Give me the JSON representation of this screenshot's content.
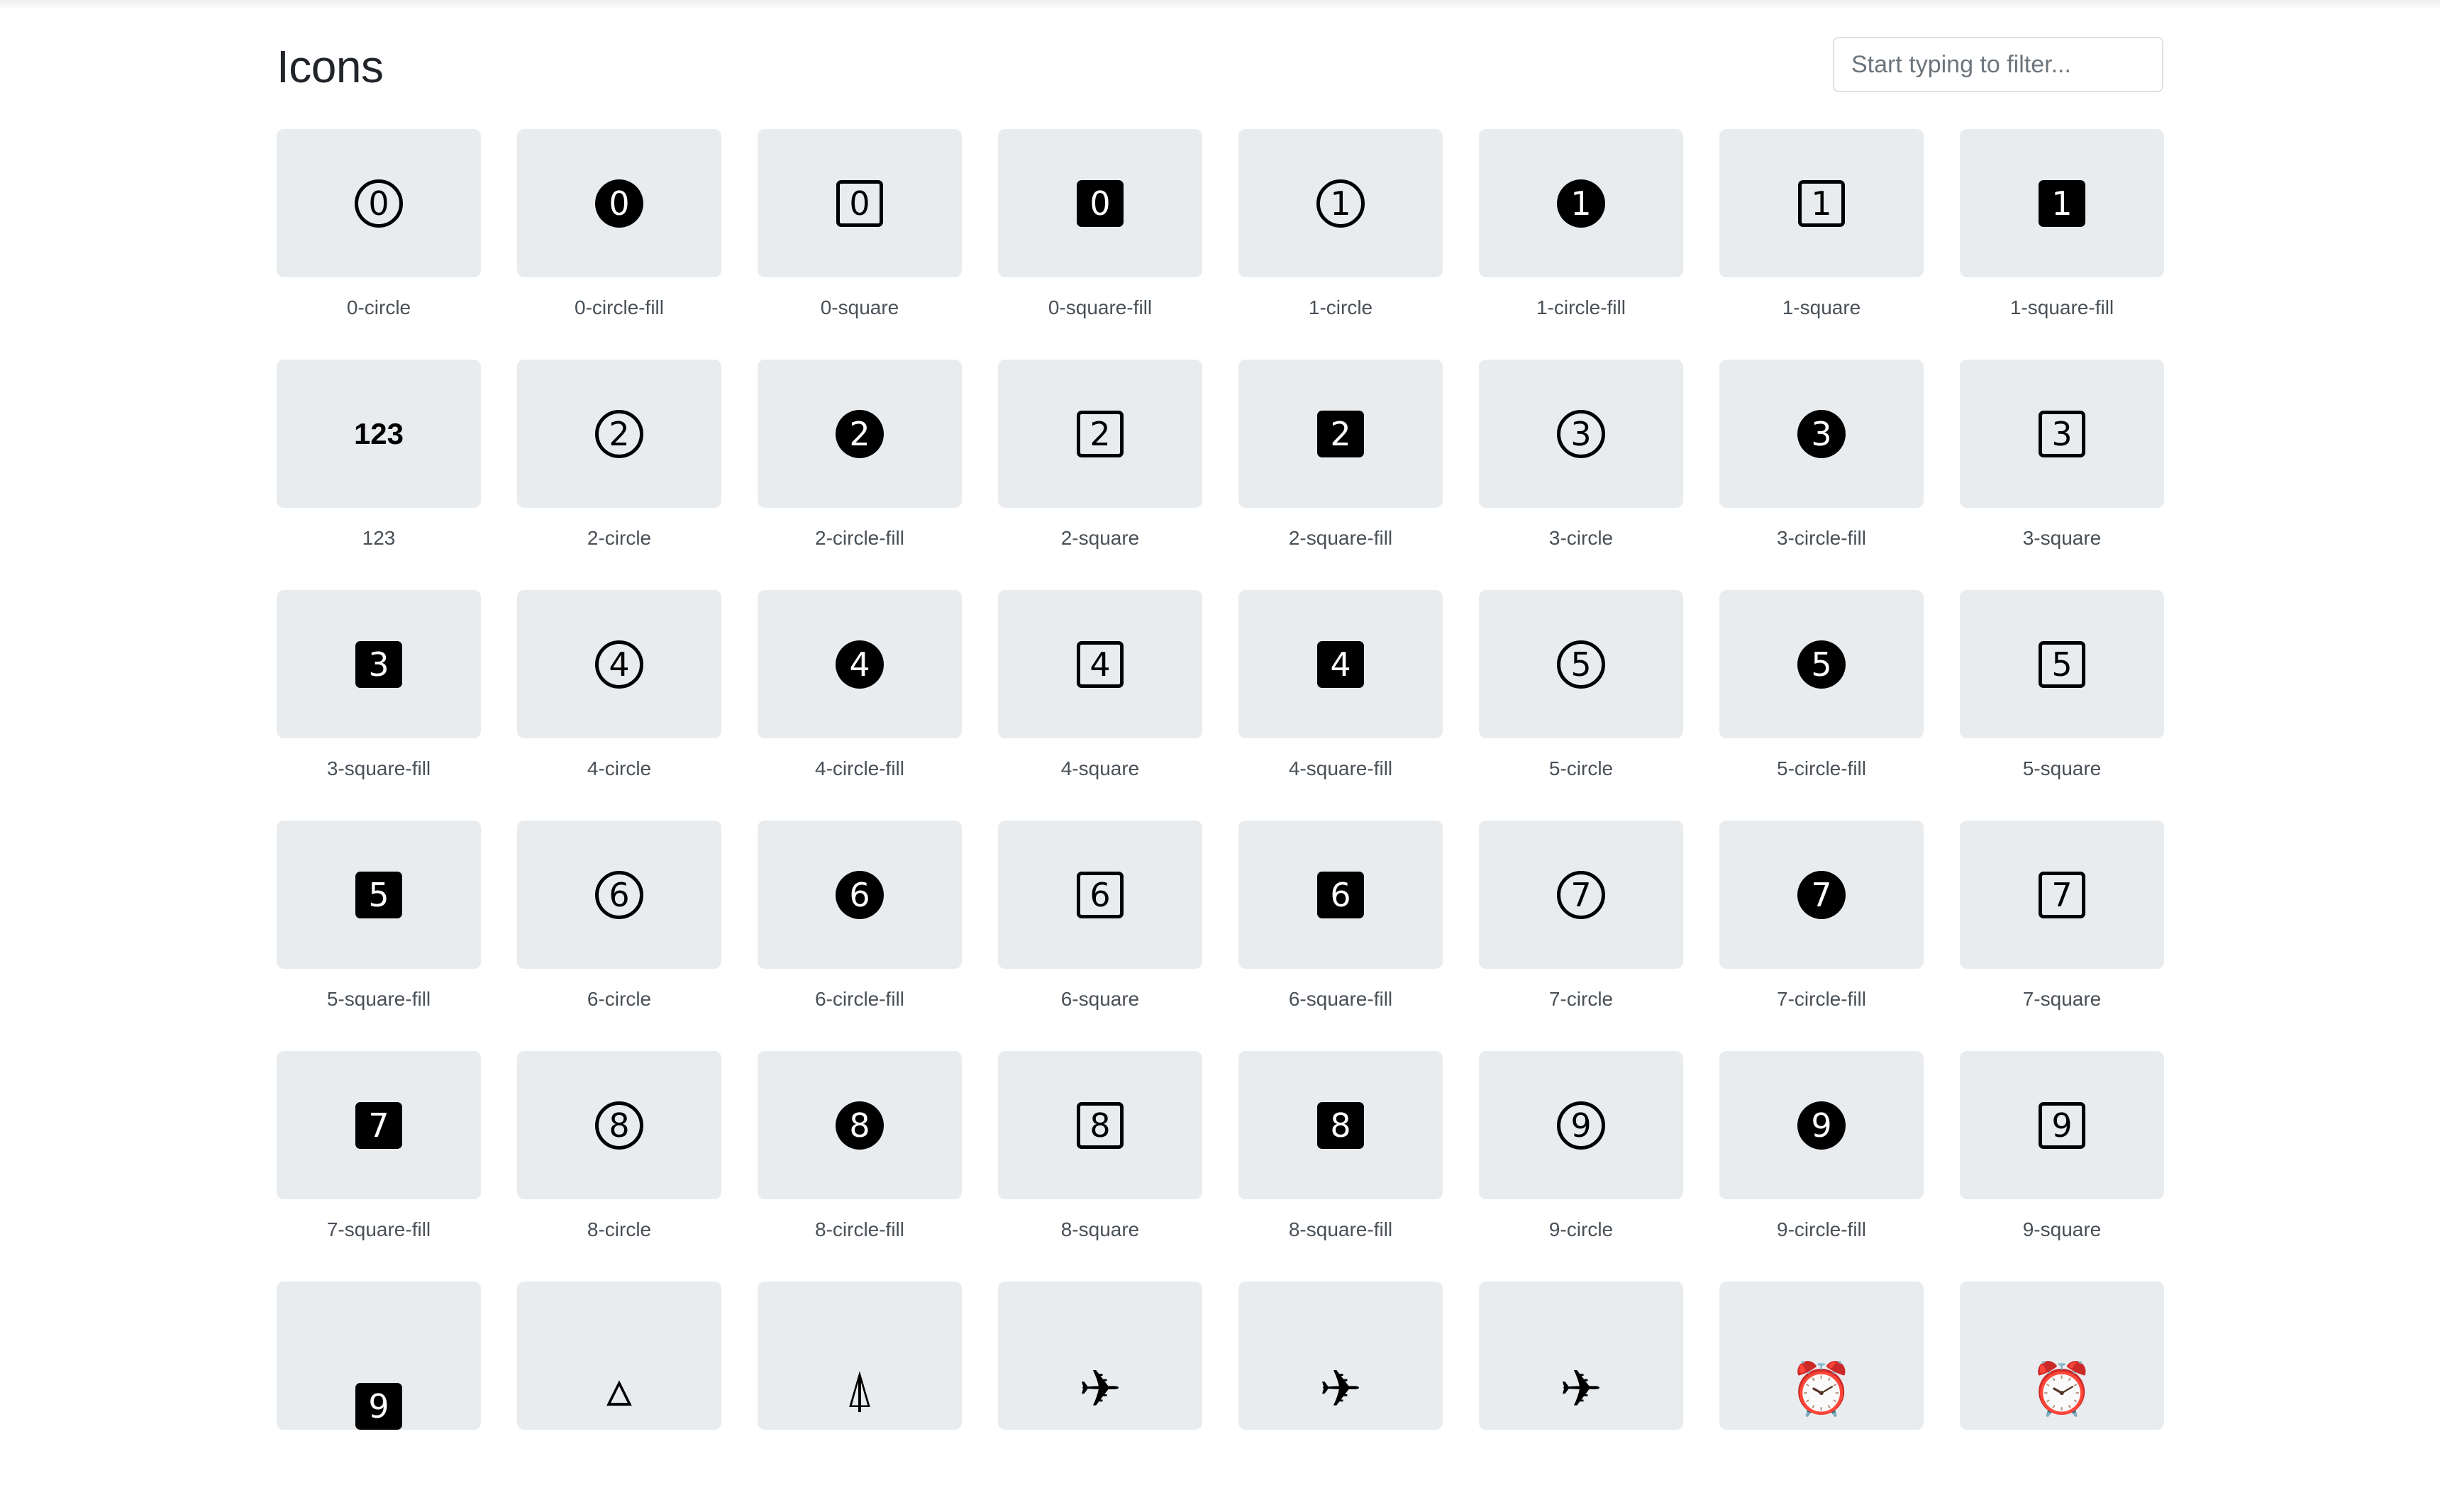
{
  "header": {
    "title": "Icons",
    "filter_placeholder": "Start typing to filter..."
  },
  "icons": [
    {
      "label": "0-circle",
      "glyph": "0",
      "style": "circle",
      "icon": "0-circle-icon"
    },
    {
      "label": "0-circle-fill",
      "glyph": "0",
      "style": "circle-fill",
      "icon": "0-circle-fill-icon"
    },
    {
      "label": "0-square",
      "glyph": "0",
      "style": "square",
      "icon": "0-square-icon"
    },
    {
      "label": "0-square-fill",
      "glyph": "0",
      "style": "square-fill",
      "icon": "0-square-fill-icon"
    },
    {
      "label": "1-circle",
      "glyph": "1",
      "style": "circle",
      "icon": "1-circle-icon"
    },
    {
      "label": "1-circle-fill",
      "glyph": "1",
      "style": "circle-fill",
      "icon": "1-circle-fill-icon"
    },
    {
      "label": "1-square",
      "glyph": "1",
      "style": "square",
      "icon": "1-square-icon"
    },
    {
      "label": "1-square-fill",
      "glyph": "1",
      "style": "square-fill",
      "icon": "1-square-fill-icon"
    },
    {
      "label": "123",
      "glyph": "123",
      "style": "text",
      "icon": "123-icon"
    },
    {
      "label": "2-circle",
      "glyph": "2",
      "style": "circle",
      "icon": "2-circle-icon"
    },
    {
      "label": "2-circle-fill",
      "glyph": "2",
      "style": "circle-fill",
      "icon": "2-circle-fill-icon"
    },
    {
      "label": "2-square",
      "glyph": "2",
      "style": "square",
      "icon": "2-square-icon"
    },
    {
      "label": "2-square-fill",
      "glyph": "2",
      "style": "square-fill",
      "icon": "2-square-fill-icon"
    },
    {
      "label": "3-circle",
      "glyph": "3",
      "style": "circle",
      "icon": "3-circle-icon"
    },
    {
      "label": "3-circle-fill",
      "glyph": "3",
      "style": "circle-fill",
      "icon": "3-circle-fill-icon"
    },
    {
      "label": "3-square",
      "glyph": "3",
      "style": "square",
      "icon": "3-square-icon"
    },
    {
      "label": "3-square-fill",
      "glyph": "3",
      "style": "square-fill",
      "icon": "3-square-fill-icon"
    },
    {
      "label": "4-circle",
      "glyph": "4",
      "style": "circle",
      "icon": "4-circle-icon"
    },
    {
      "label": "4-circle-fill",
      "glyph": "4",
      "style": "circle-fill",
      "icon": "4-circle-fill-icon"
    },
    {
      "label": "4-square",
      "glyph": "4",
      "style": "square",
      "icon": "4-square-icon"
    },
    {
      "label": "4-square-fill",
      "glyph": "4",
      "style": "square-fill",
      "icon": "4-square-fill-icon"
    },
    {
      "label": "5-circle",
      "glyph": "5",
      "style": "circle",
      "icon": "5-circle-icon"
    },
    {
      "label": "5-circle-fill",
      "glyph": "5",
      "style": "circle-fill",
      "icon": "5-circle-fill-icon"
    },
    {
      "label": "5-square",
      "glyph": "5",
      "style": "square",
      "icon": "5-square-icon"
    },
    {
      "label": "5-square-fill",
      "glyph": "5",
      "style": "square-fill",
      "icon": "5-square-fill-icon"
    },
    {
      "label": "6-circle",
      "glyph": "6",
      "style": "circle",
      "icon": "6-circle-icon"
    },
    {
      "label": "6-circle-fill",
      "glyph": "6",
      "style": "circle-fill",
      "icon": "6-circle-fill-icon"
    },
    {
      "label": "6-square",
      "glyph": "6",
      "style": "square",
      "icon": "6-square-icon"
    },
    {
      "label": "6-square-fill",
      "glyph": "6",
      "style": "square-fill",
      "icon": "6-square-fill-icon"
    },
    {
      "label": "7-circle",
      "glyph": "7",
      "style": "circle",
      "icon": "7-circle-icon"
    },
    {
      "label": "7-circle-fill",
      "glyph": "7",
      "style": "circle-fill",
      "icon": "7-circle-fill-icon"
    },
    {
      "label": "7-square",
      "glyph": "7",
      "style": "square",
      "icon": "7-square-icon"
    },
    {
      "label": "7-square-fill",
      "glyph": "7",
      "style": "square-fill",
      "icon": "7-square-fill-icon"
    },
    {
      "label": "8-circle",
      "glyph": "8",
      "style": "circle",
      "icon": "8-circle-icon"
    },
    {
      "label": "8-circle-fill",
      "glyph": "8",
      "style": "circle-fill",
      "icon": "8-circle-fill-icon"
    },
    {
      "label": "8-square",
      "glyph": "8",
      "style": "square",
      "icon": "8-square-icon"
    },
    {
      "label": "8-square-fill",
      "glyph": "8",
      "style": "square-fill",
      "icon": "8-square-fill-icon"
    },
    {
      "label": "9-circle",
      "glyph": "9",
      "style": "circle",
      "icon": "9-circle-icon"
    },
    {
      "label": "9-circle-fill",
      "glyph": "9",
      "style": "circle-fill",
      "icon": "9-circle-fill-icon"
    },
    {
      "label": "9-square",
      "glyph": "9",
      "style": "square",
      "icon": "9-square-icon"
    },
    {
      "label": "",
      "glyph": "9",
      "style": "square-fill-cut",
      "icon": "9-square-fill-icon"
    },
    {
      "label": "",
      "glyph": "▵",
      "style": "glyph",
      "icon": "triangle-outline-icon"
    },
    {
      "label": "",
      "glyph": "⍋",
      "style": "glyph",
      "icon": "airplane-engines-icon"
    },
    {
      "label": "",
      "glyph": "✈",
      "style": "glyph",
      "icon": "airplane-outline-icon"
    },
    {
      "label": "",
      "glyph": "✈",
      "style": "glyph",
      "icon": "airplane-fill-icon"
    },
    {
      "label": "",
      "glyph": "✈",
      "style": "glyph",
      "icon": "airplane-icon"
    },
    {
      "label": "",
      "glyph": "⏰",
      "style": "glyph",
      "icon": "alarm-icon"
    },
    {
      "label": "",
      "glyph": "⏰",
      "style": "glyph",
      "icon": "alarm-fill-icon"
    }
  ]
}
